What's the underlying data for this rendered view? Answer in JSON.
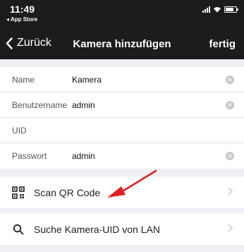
{
  "status": {
    "time": "11:49",
    "back_app": "◂ App Store"
  },
  "nav": {
    "back_label": "Zurück",
    "title": "Kamera hinzufügen",
    "done_label": "fertig"
  },
  "form": {
    "rows": [
      {
        "label": "Name",
        "value": "Kamera"
      },
      {
        "label": "Benutzername",
        "value": "admin"
      },
      {
        "label": "UID",
        "value": ""
      },
      {
        "label": "Passwort",
        "value": "admin"
      }
    ]
  },
  "actions": {
    "scan_qr": "Scan QR Code",
    "search_uid": "Suche Kamera-UID von LAN"
  },
  "colors": {
    "header_bg": "#1c1c1e",
    "annotation_arrow": "#e02020",
    "background": "#efeff4"
  }
}
